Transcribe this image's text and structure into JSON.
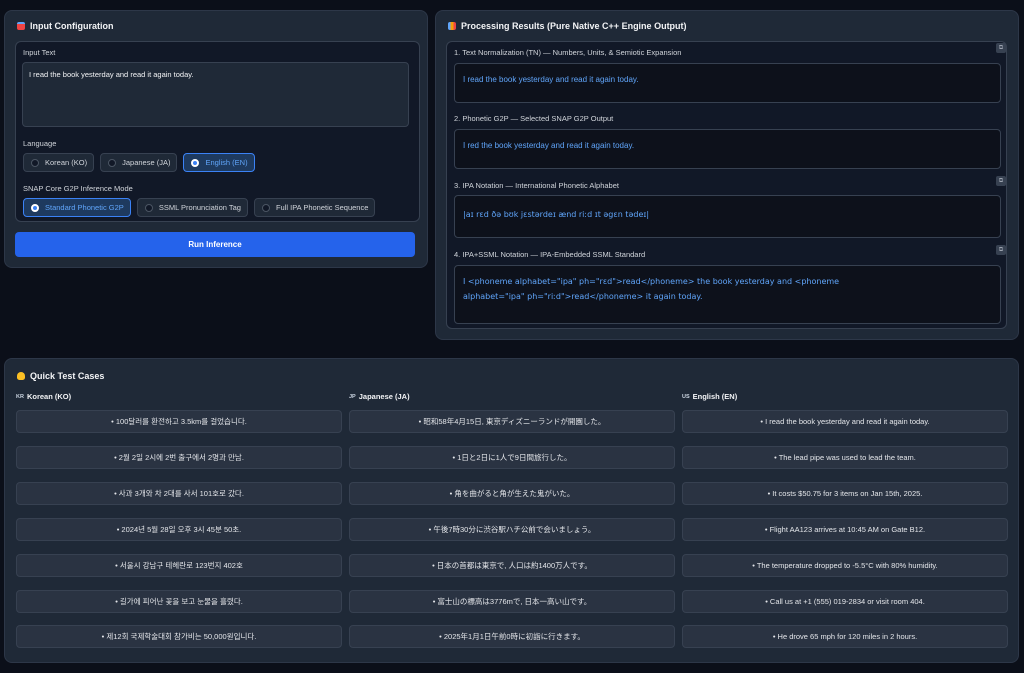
{
  "input_panel": {
    "title": "Input Configuration",
    "input_label": "Input Text",
    "input_value": "I read the book yesterday and read it again today.",
    "language_label": "Language",
    "languages": [
      "Korean (KO)",
      "Japanese (JA)",
      "English (EN)"
    ],
    "selected_language": "English (EN)",
    "mode_label": "SNAP Core G2P Inference Mode",
    "modes": [
      "Standard Phonetic G2P",
      "SSML Pronunciation Tag",
      "Full IPA Phonetic Sequence"
    ],
    "selected_mode": "Standard Phonetic G2P",
    "run_label": "Run Inference"
  },
  "results_panel": {
    "title": "Processing Results (Pure Native C++ Engine Output)",
    "results": [
      {
        "label": "1. Text Normalization (TN) — Numbers, Units, & Semiotic Expansion",
        "value": "I read the book yesterday and read it again today."
      },
      {
        "label": "2. Phonetic G2P — Selected SNAP G2P Output",
        "value": "I red the book yesterday and read it again today."
      },
      {
        "label": "3. IPA Notation — International Phonetic Alphabet",
        "value": "|aɪ rɛd ðə bʊk jɛstərdeɪ ænd riːd ɪt əgɛn tədeɪ|"
      },
      {
        "label": "4. IPA+SSML Notation — IPA-Embedded SSML Standard",
        "value": "I <phoneme alphabet=\"ipa\" ph=\"rɛd\">read</phoneme> the book yesterday and <phoneme alphabet=\"ipa\" ph=\"riːd\">read</phoneme> it again today."
      }
    ]
  },
  "quick_tests": {
    "title": "Quick Test Cases",
    "columns": [
      {
        "flag": "KR",
        "header": "Korean (KO)",
        "cases": [
          "• 100달러를 환전하고 3.5km를 걸었습니다.",
          "• 2월 2일 2시에 2번 출구에서 2명과 만남.",
          "• 사과 3개와 차 2대를 사서 101호로 갔다.",
          "• 2024년 5월 28일 오후 3시 45분 50초.",
          "• 서울시 강남구 테헤란로 123번지 402호",
          "• 길가에 피어난 꽃을 보고 눈물을 흘렸다.",
          "• 제12회 국제학술대회 참가비는 50,000원입니다."
        ]
      },
      {
        "flag": "JP",
        "header": "Japanese (JA)",
        "cases": [
          "• 昭和58年4月15日, 東京ディズニーランドが開園した。",
          "• 1日と2日に1人で9日間旅行した。",
          "• 角を曲がると角が生えた鬼がいた。",
          "• 午後7時30分に渋谷駅ハチ公前で会いましょう。",
          "• 日本の首都は東京で, 人口は約1400万人です。",
          "• 富士山の標高は3776mで, 日本一高い山です。",
          "• 2025年1月1日午前0時に初詣に行きます。"
        ]
      },
      {
        "flag": "US",
        "header": "English (EN)",
        "cases": [
          "• I read the book yesterday and read it again today.",
          "• The lead pipe was used to lead the team.",
          "• It costs $50.75 for 3 items on Jan 15th, 2025.",
          "• Flight AA123 arrives at 10:45 AM on Gate B12.",
          "• The temperature dropped to -5.5°C with 80% humidity.",
          "• Call us at +1 (555) 019-2834 or visit room 404.",
          "• He drove 65 mph for 120 miles in 2 hours."
        ]
      }
    ]
  },
  "colors": {
    "accent": "#2563eb",
    "selected_text": "#60a5fa",
    "panel": "#1f2937",
    "background": "#0b0f19"
  },
  "icons": {
    "input_panel": "clipboard-icon",
    "results_panel": "bar-chart-icon",
    "quick_tests": "lightbulb-icon",
    "copy": "copy-icon"
  }
}
